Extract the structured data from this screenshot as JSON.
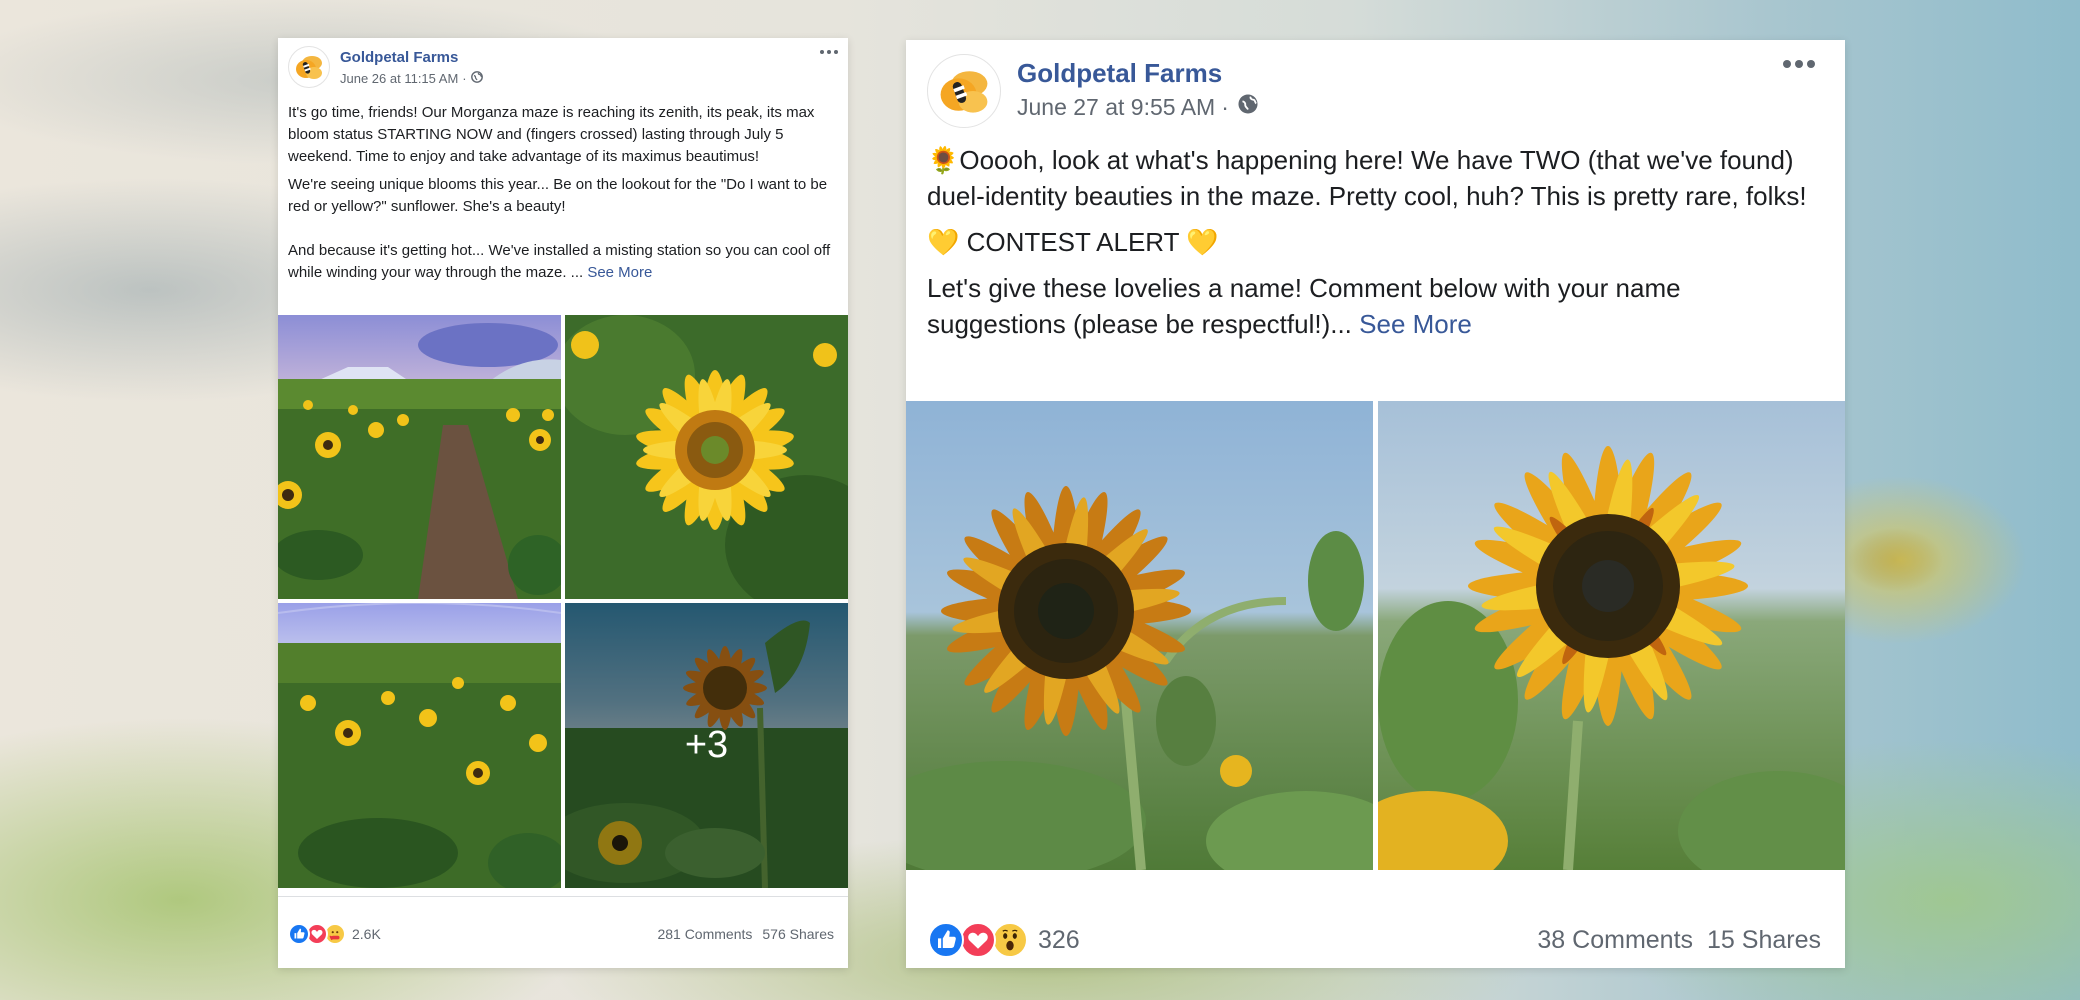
{
  "posts": [
    {
      "page_name": "Goldpetal Farms",
      "timestamp": "June 26 at 11:15 AM",
      "separator": "·",
      "privacy_icon": "globe-icon",
      "more_icon": "more-options-icon",
      "paragraphs": [
        "It's go time, friends! Our Morganza maze is reaching its zenith, its peak, its max bloom status STARTING NOW and (fingers crossed) lasting through July 5 weekend. Time to enjoy and take advantage of its maximus beautimus!",
        "We're seeing unique blooms this year... Be on the lookout for the \"Do I want to be red or yellow?\" sunflower. She's a beauty!",
        "And because it's getting hot... We've installed a misting station so you can cool off while winding your way through the maze. ..."
      ],
      "see_more": "See More",
      "photos": [
        {
          "description": "sunflower maze path with tent and greenhouse at dusk"
        },
        {
          "description": "close-up yellow sunflower"
        },
        {
          "description": "sunflower field under greenhouse"
        },
        {
          "description": "single orange sunflower against sky",
          "more_count_label": "+3"
        }
      ],
      "reactions": [
        "like",
        "love",
        "care"
      ],
      "reaction_count": "2.6K",
      "comments": "281 Comments",
      "shares": "576 Shares"
    },
    {
      "page_name": "Goldpetal Farms",
      "timestamp": "June 27 at 9:55 AM",
      "separator": "·",
      "privacy_icon": "globe-icon",
      "more_icon": "more-options-icon",
      "paragraphs": [
        "🌻Ooooh, look at what's happening here! We have TWO (that we've found) duel-identity beauties in the maze. Pretty cool, huh? This is pretty rare, folks!",
        "💛 CONTEST ALERT 💛",
        "Let's give these lovelies a name! Comment below with your name suggestions (please be respectful!)..."
      ],
      "see_more": "See More",
      "photos": [
        {
          "description": "bicolor orange-brown sunflower with bud"
        },
        {
          "description": "bicolor yellow-orange sunflower"
        }
      ],
      "reactions": [
        "like",
        "love",
        "wow"
      ],
      "reaction_count": "326",
      "comments": "38 Comments",
      "shares": "15 Shares"
    }
  ],
  "colors": {
    "link_blue": "#385898",
    "meta_gray": "#606770",
    "text": "#1c1e21",
    "like_blue": "#1877f2",
    "love_red": "#f33e58",
    "emoji_yellow": "#f7c945"
  }
}
